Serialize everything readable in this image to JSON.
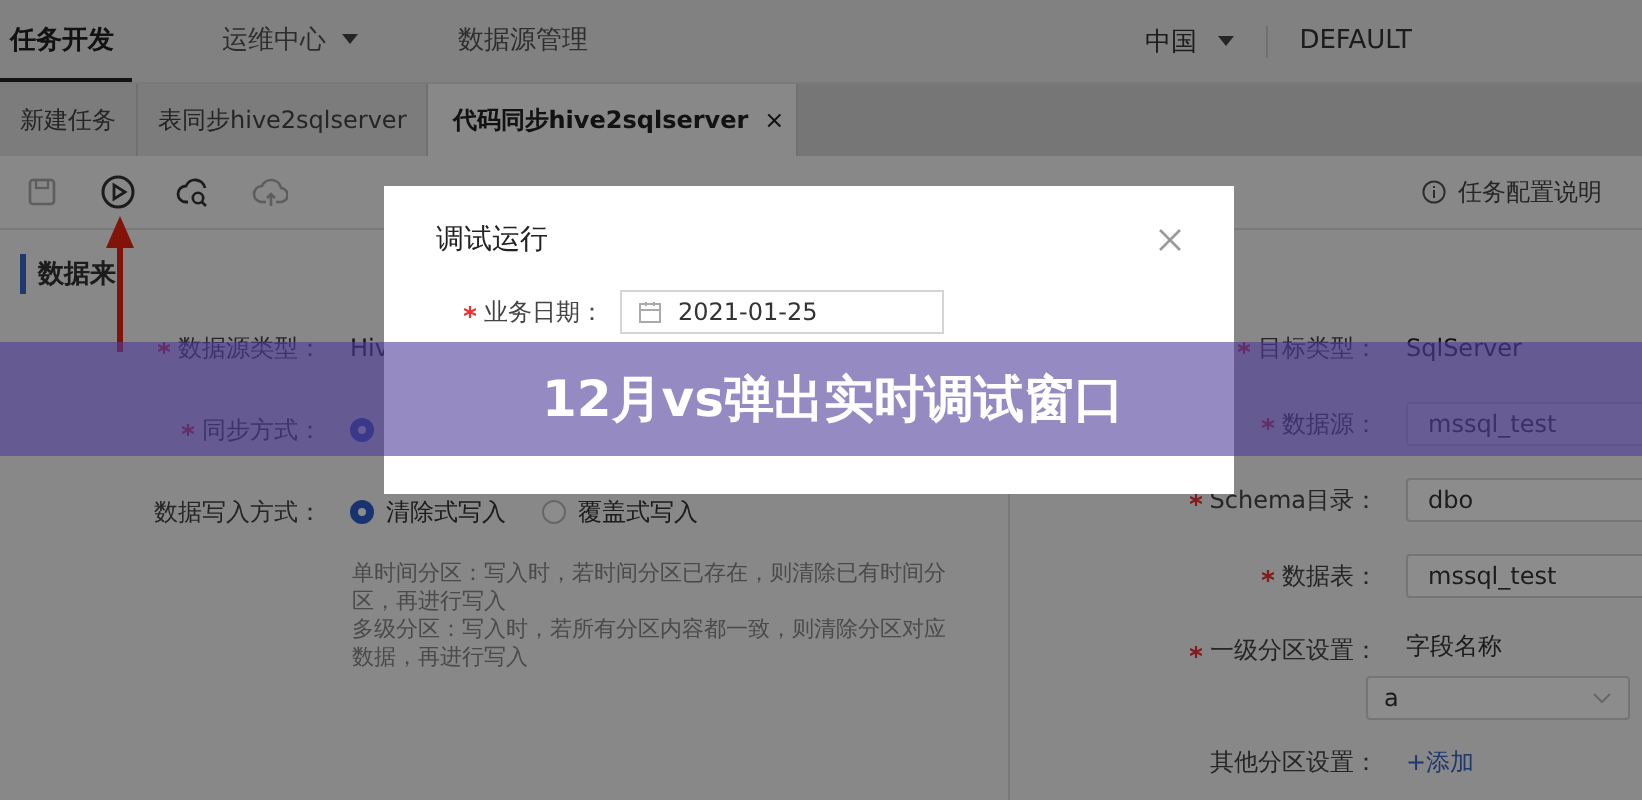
{
  "nav": {
    "items": [
      {
        "label": "任务开发",
        "selected": true,
        "dropdown": false
      },
      {
        "label": "运维中心",
        "selected": false,
        "dropdown": true
      },
      {
        "label": "数据源管理",
        "selected": false,
        "dropdown": false
      }
    ],
    "region": "中国",
    "tenant": "DEFAULT"
  },
  "tabs": [
    {
      "label": "新建任务",
      "selected": false
    },
    {
      "label": "表同步hive2sqlserver",
      "selected": false
    },
    {
      "label": "代码同步hive2sqlserver",
      "selected": true,
      "close": "×"
    }
  ],
  "toolbar": {
    "tools": [
      {
        "kind": "save",
        "disabled": true
      },
      {
        "kind": "run",
        "disabled": false
      },
      {
        "kind": "cloud-search",
        "disabled": false
      },
      {
        "kind": "cloud-upload",
        "disabled": true
      }
    ],
    "help": "任务配置说明"
  },
  "source": {
    "heading": "数据来",
    "fields": [
      {
        "kind": "text",
        "label": "数据源类型：",
        "required": true,
        "value": "Hiv"
      },
      {
        "kind": "radio",
        "label": "同步方式：",
        "required": true,
        "options": [
          {
            "selected": true
          }
        ]
      },
      {
        "kind": "radio",
        "label": "数据写入方式：",
        "required": false,
        "options": [
          {
            "label": "清除式写入",
            "selected": true
          },
          {
            "label": "覆盖式写入",
            "selected": false
          }
        ],
        "help": [
          "单时间分区：写入时，若时间分区已存在，则清除已有时间分",
          "区，再进行写入",
          "多级分区：写入时，若所有分区内容都一致，则清除分区对应",
          "数据，再进行写入"
        ]
      }
    ]
  },
  "target": {
    "fields": [
      {
        "kind": "text",
        "label": "目标类型：",
        "required": true,
        "value": "SqlServer"
      },
      {
        "kind": "input",
        "label": "数据源：",
        "required": true,
        "value": "mssql_test"
      },
      {
        "kind": "input",
        "label": "Schema目录：",
        "required": true,
        "value": "dbo"
      },
      {
        "kind": "input",
        "label": "数据表：",
        "required": true,
        "value": "mssql_test"
      },
      {
        "kind": "partition",
        "label": "一级分区设置：",
        "required": true,
        "caption": "字段名称",
        "value": "a"
      },
      {
        "kind": "add",
        "label": "其他分区设置：",
        "required": false,
        "value": "+添加"
      }
    ]
  },
  "dialog": {
    "title": "调试运行",
    "fields": [
      {
        "label": "业务日期：",
        "required": true,
        "value": "2021-01-25"
      }
    ]
  },
  "banner": {
    "text": "12月vs弹出实时调试窗口"
  }
}
